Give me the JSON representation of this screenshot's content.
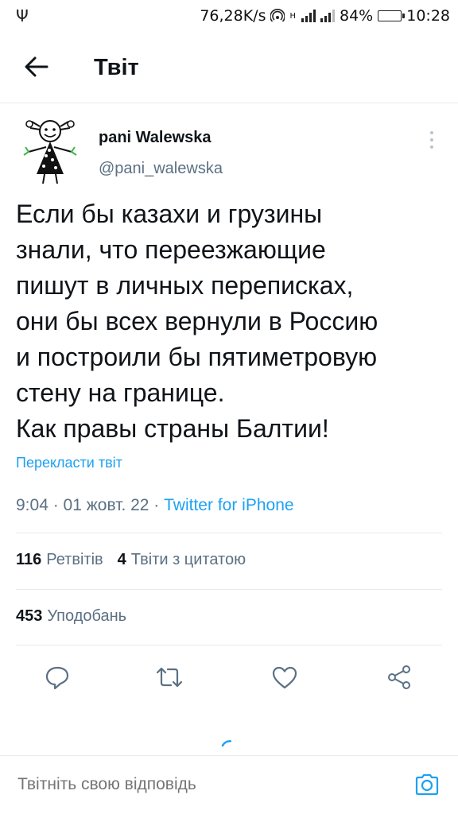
{
  "status_bar": {
    "net_speed": "76,28K/s",
    "net_type": "H",
    "battery_percent": "84%",
    "battery_level": 0.84,
    "time": "10:28"
  },
  "header": {
    "title": "Твіт"
  },
  "tweet": {
    "author_name": "pani Walewska",
    "author_handle": "@pani_walewska",
    "text_lines": [
      "Если бы казахи и грузины",
      "знали, что переезжающие",
      "пишут в личных переписках,",
      "они бы всех вернули в Россию",
      "и построили бы пятиметровую",
      "стену на границе.",
      "Как правы страны Балтии!"
    ],
    "translate_label": "Перекласти твіт",
    "time": "9:04 · 01 жовт. 22 · ",
    "source": "Twitter for iPhone"
  },
  "stats": {
    "retweets_count": "116",
    "retweets_label": "Ретвітів",
    "quotes_count": "4",
    "quotes_label": "Твіти з цитатою",
    "likes_count": "453",
    "likes_label": "Уподобань"
  },
  "actions": {
    "icons": [
      "reply-icon",
      "retweet-icon",
      "like-icon",
      "share-icon"
    ]
  },
  "reply": {
    "placeholder": "Твітніть свою відповідь"
  },
  "colors": {
    "accent": "#1da1f2",
    "secondary_text": "#5b7083",
    "divider": "#e6ecf0"
  }
}
